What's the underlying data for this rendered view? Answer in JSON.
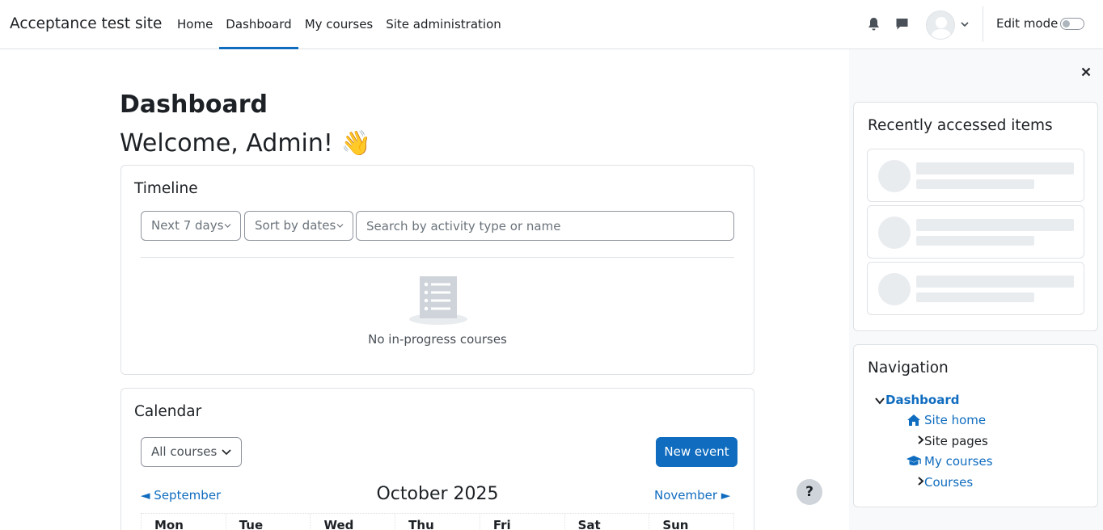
{
  "header": {
    "site_name": "Acceptance test site",
    "nav": [
      {
        "label": "Home",
        "active": false
      },
      {
        "label": "Dashboard",
        "active": true
      },
      {
        "label": "My courses",
        "active": false
      },
      {
        "label": "Site administration",
        "active": false
      }
    ],
    "icons": {
      "notifications": "bell-icon",
      "messages": "chat-icon",
      "user": "avatar"
    },
    "edit_mode_label": "Edit mode",
    "edit_mode_on": false,
    "accent_color": "#0f6cbf"
  },
  "main": {
    "page_title": "Dashboard",
    "welcome": "Welcome, Admin! 👋",
    "timeline": {
      "title": "Timeline",
      "day_filter": "Next 7 days",
      "sort_filter": "Sort by dates",
      "search_placeholder": "Search by activity type or name",
      "empty_message": "No in-progress courses"
    },
    "calendar": {
      "title": "Calendar",
      "course_filter": "All courses",
      "new_event_label": "New event",
      "prev_month": "◄  September",
      "current_month": "October 2025",
      "next_month": "November  ►",
      "weekdays": [
        "Mon",
        "Tue",
        "Wed",
        "Thu",
        "Fri",
        "Sat",
        "Sun"
      ]
    },
    "help_label": "?"
  },
  "drawer": {
    "recent": {
      "title": "Recently accessed items",
      "placeholders": 3
    },
    "navigation": {
      "title": "Navigation",
      "items": [
        {
          "label": "Dashboard"
        },
        {
          "label": "Site home"
        },
        {
          "label": "Site pages"
        },
        {
          "label": "My courses"
        },
        {
          "label": "Courses"
        }
      ]
    }
  }
}
